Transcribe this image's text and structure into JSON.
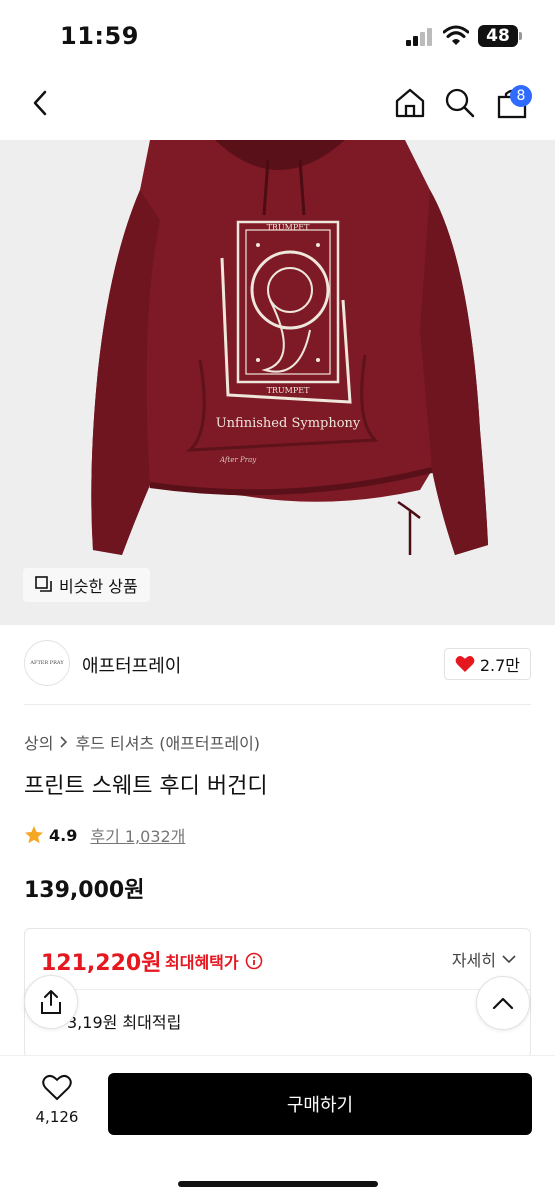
{
  "status": {
    "time": "11:59",
    "battery": "48"
  },
  "nav": {
    "cart_count": "8"
  },
  "image": {
    "print_top": "TRUMPET",
    "print_bottom": "TRUMPET",
    "print_caption": "Unfinished Symphony",
    "signature": "After Pray",
    "similar_label": "비슷한 상품"
  },
  "brand": {
    "name": "애프터프레이",
    "logo_text": "AFTER PRAY",
    "likes": "2.7만"
  },
  "breadcrumb": {
    "category": "상의",
    "subcategory": "후드 티셔츠 (애프터프레이)"
  },
  "product": {
    "title": "프린트 스웨트 후디 버건디",
    "rating": "4.9",
    "reviews": "후기 1,032개",
    "price": "139,000원"
  },
  "benefit": {
    "price": "121,220원",
    "label": "최대혜택가",
    "detail": "자세히",
    "points": "3,19원 최대적립"
  },
  "bottom": {
    "wish_count": "4,126",
    "buy_label": "구매하기"
  },
  "colors": {
    "accent_red": "#e5171f",
    "badge_blue": "#2f6bff",
    "hoodie": "#7e1a26"
  }
}
